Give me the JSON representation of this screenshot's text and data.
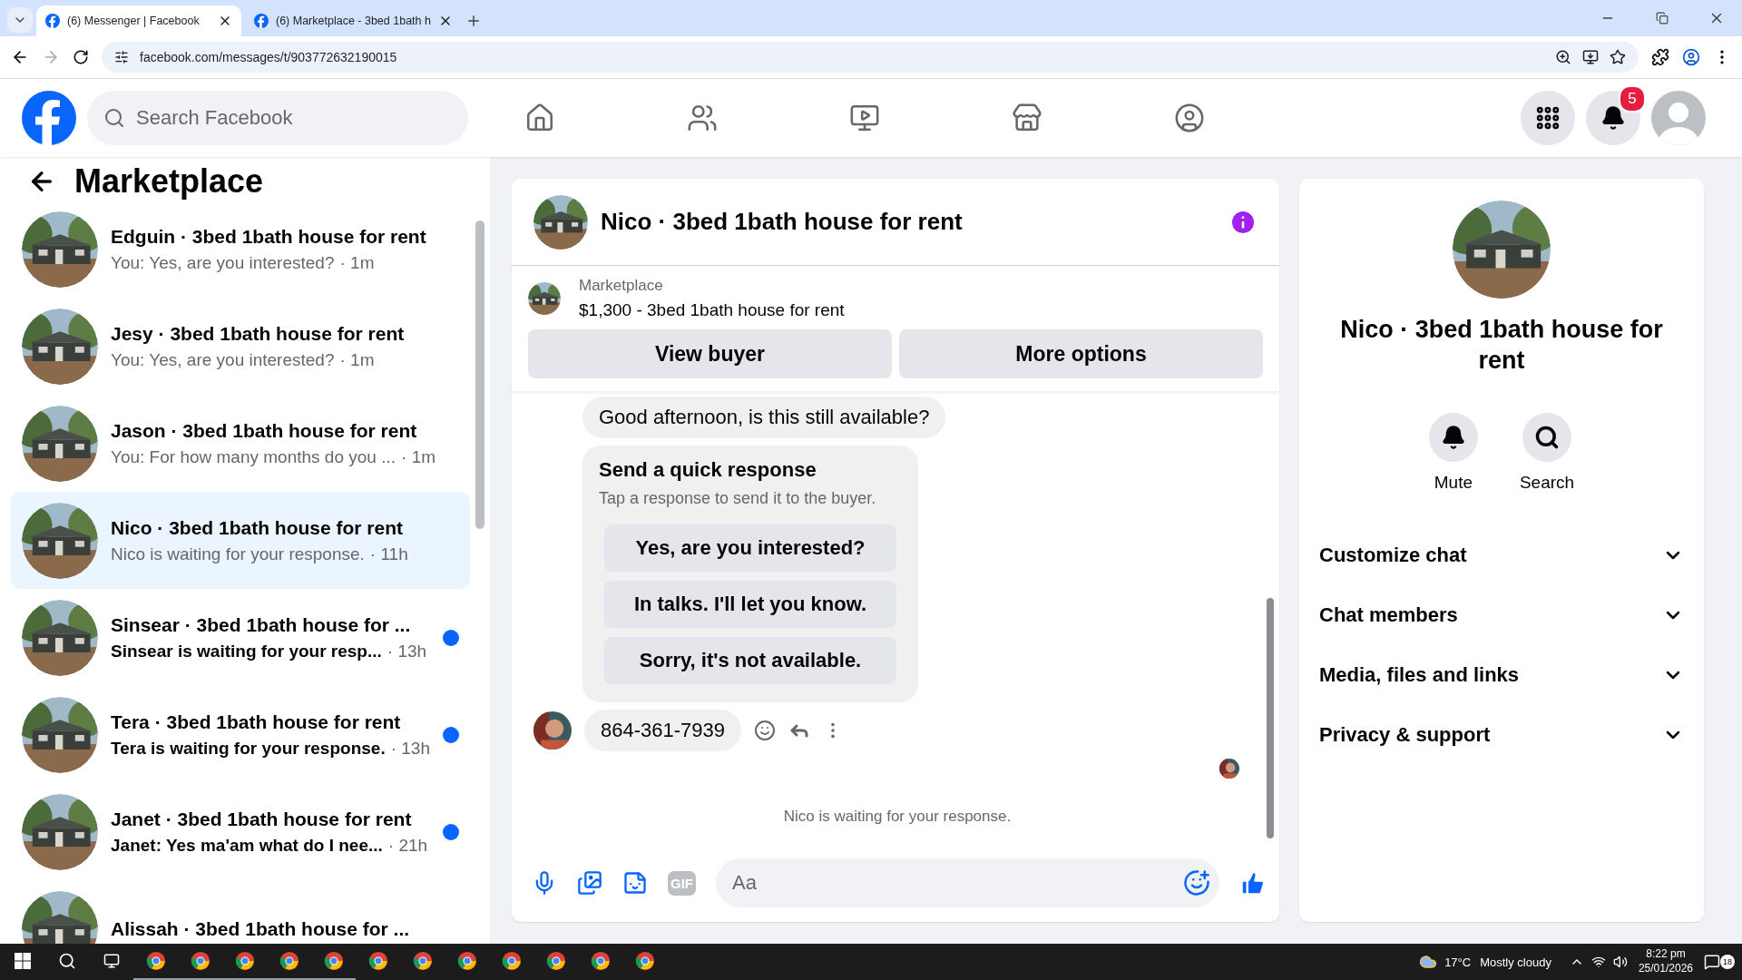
{
  "browser": {
    "tabs": [
      {
        "title": "(6) Messenger | Facebook",
        "selected": true
      },
      {
        "title": "(6) Marketplace - 3bed 1bath h",
        "selected": false
      }
    ],
    "url": "facebook.com/messages/t/903772632190015"
  },
  "header": {
    "search_placeholder": "Search Facebook",
    "nav": [
      {
        "kind": "home"
      },
      {
        "kind": "friends"
      },
      {
        "kind": "video"
      },
      {
        "kind": "marketplace"
      },
      {
        "kind": "groups"
      }
    ],
    "notification_count": "5"
  },
  "sidebar": {
    "title": "Marketplace",
    "conversations": [
      {
        "name": "Edguin · 3bed 1bath house for rent",
        "preview": "You: Yes, are you interested?",
        "time": "· 1m",
        "unread": false,
        "selected": false
      },
      {
        "name": "Jesy · 3bed 1bath house for rent",
        "preview": "You: Yes, are you interested?",
        "time": "· 1m",
        "unread": false,
        "selected": false
      },
      {
        "name": "Jason · 3bed 1bath house for rent",
        "preview": "You: For how many months do you ...",
        "time": "· 1m",
        "unread": false,
        "selected": false
      },
      {
        "name": "Nico · 3bed 1bath house for rent",
        "preview": "Nico is waiting for your response.",
        "time": "· 11h",
        "unread": false,
        "selected": true
      },
      {
        "name": "Sinsear · 3bed 1bath house for ...",
        "preview": "Sinsear is waiting for your resp...",
        "time": "· 13h",
        "unread": true,
        "selected": false
      },
      {
        "name": "Tera · 3bed 1bath house for rent",
        "preview": "Tera is waiting for your response.",
        "time": "· 13h",
        "unread": true,
        "selected": false
      },
      {
        "name": "Janet · 3bed 1bath house for rent",
        "preview": "Janet: Yes ma'am what do I nee...",
        "time": "· 21h",
        "unread": true,
        "selected": false
      },
      {
        "name": "Alissah · 3bed 1bath house for ...",
        "unread": false,
        "selected": false
      }
    ]
  },
  "chat": {
    "title": "Nico · 3bed 1bath house for rent",
    "listing": {
      "source": "Marketplace",
      "title": "$1,300 - 3bed 1bath house for rent"
    },
    "buttons": [
      "View buyer",
      "More options"
    ],
    "first_message": "Good afternoon, is this still available?",
    "quick_response": {
      "title": "Send a quick response",
      "hint": "Tap a response to send it to the buyer.",
      "options": [
        "Yes, are you interested?",
        "In talks. I'll let you know.",
        "Sorry, it's not available."
      ]
    },
    "phone_message": "864-361-7939",
    "status": "Nico is waiting for your response.",
    "composer_placeholder": "Aa",
    "gif_label": "GIF"
  },
  "details": {
    "name": "Nico · 3bed 1bath house for rent",
    "actions": [
      {
        "kind": "mute",
        "label": "Mute"
      },
      {
        "kind": "search",
        "label": "Search"
      }
    ],
    "sections": [
      "Customize chat",
      "Chat members",
      "Media, files and links",
      "Privacy & support"
    ]
  },
  "taskbar": {
    "apps": [
      {
        "open": true
      },
      {
        "open": true
      },
      {
        "open": true
      },
      {
        "open": true
      },
      {
        "open": true
      },
      {
        "open": false
      },
      {
        "open": false
      },
      {
        "open": false
      },
      {
        "open": false
      },
      {
        "open": false
      },
      {
        "open": false
      },
      {
        "open": false
      }
    ],
    "temperature": "17°C",
    "weather": "Mostly cloudy",
    "time": "8:22 pm",
    "date": "25/01/2026",
    "notifications": "18"
  }
}
